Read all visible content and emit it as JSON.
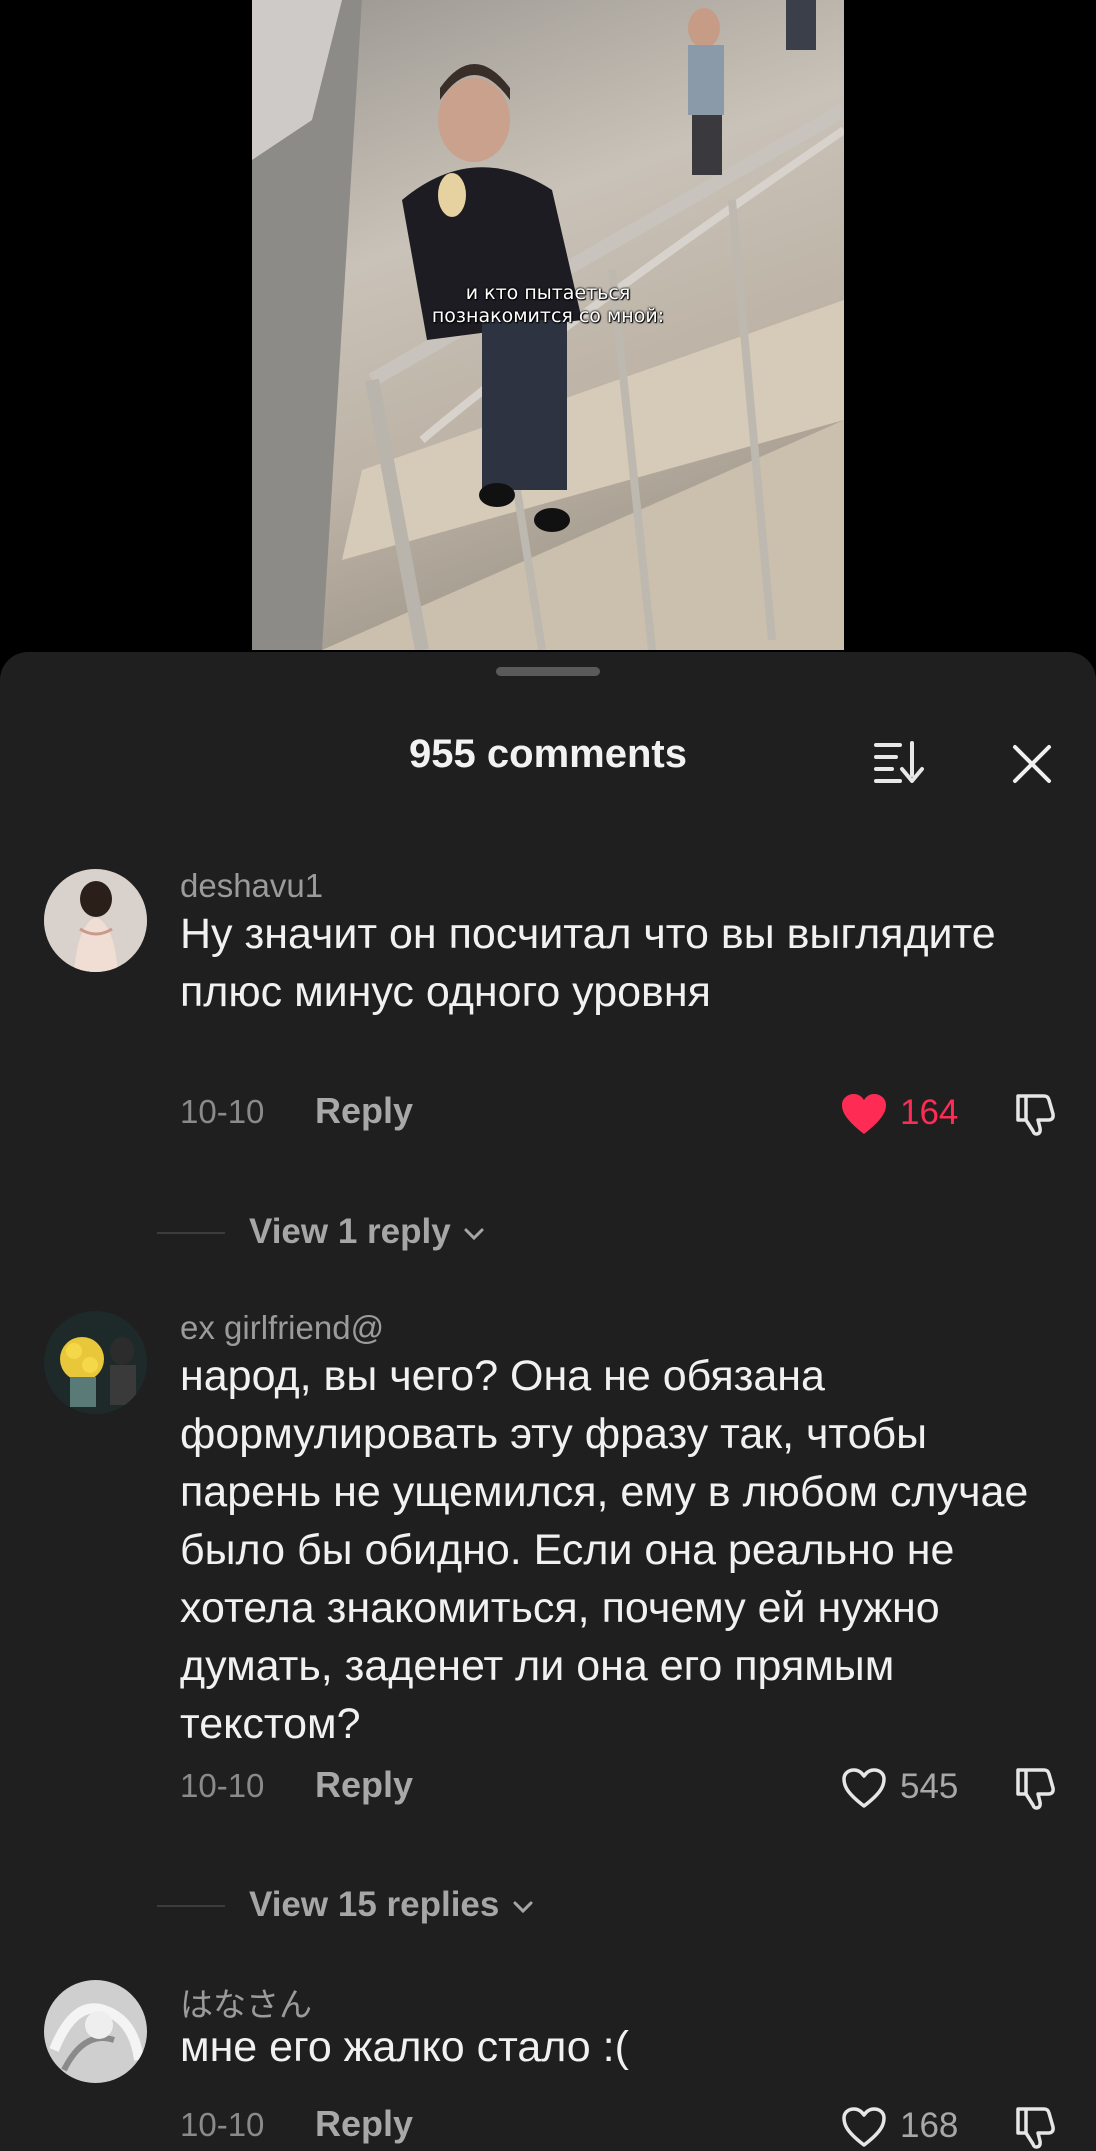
{
  "video": {
    "caption_line1": "и кто пытаеться",
    "caption_line2": "познакомится со мной:"
  },
  "comments_sheet": {
    "title": "955 comments",
    "sort_icon": "sort-icon",
    "close_icon": "close-icon",
    "comments": [
      {
        "username": "deshavu1",
        "text": "Ну значит он посчитал что вы выглядите плюс минус одного уровня",
        "date": "10-10",
        "reply_label": "Reply",
        "likes": "164",
        "liked": true,
        "view_replies": "View 1 reply"
      },
      {
        "username": "ex girlfriend@",
        "text": "народ, вы чего? Она не обязана формулировать эту фразу так, чтобы парень не ущемился, ему в любом случае было бы обидно. Если она реально не хотела знакомиться, почему ей нужно думать, заденет ли она его прямым текстом?",
        "date": "10-10",
        "reply_label": "Reply",
        "likes": "545",
        "liked": false,
        "view_replies": "View 15 replies"
      },
      {
        "username": "はなさん",
        "text": "мне его жалко стало :(",
        "date": "10-10",
        "reply_label": "Reply",
        "likes": "168",
        "liked": false
      }
    ]
  },
  "colors": {
    "sheet_bg": "#1f1f1f",
    "like_active": "#fe2c55",
    "secondary_text": "#9b9b9b"
  }
}
